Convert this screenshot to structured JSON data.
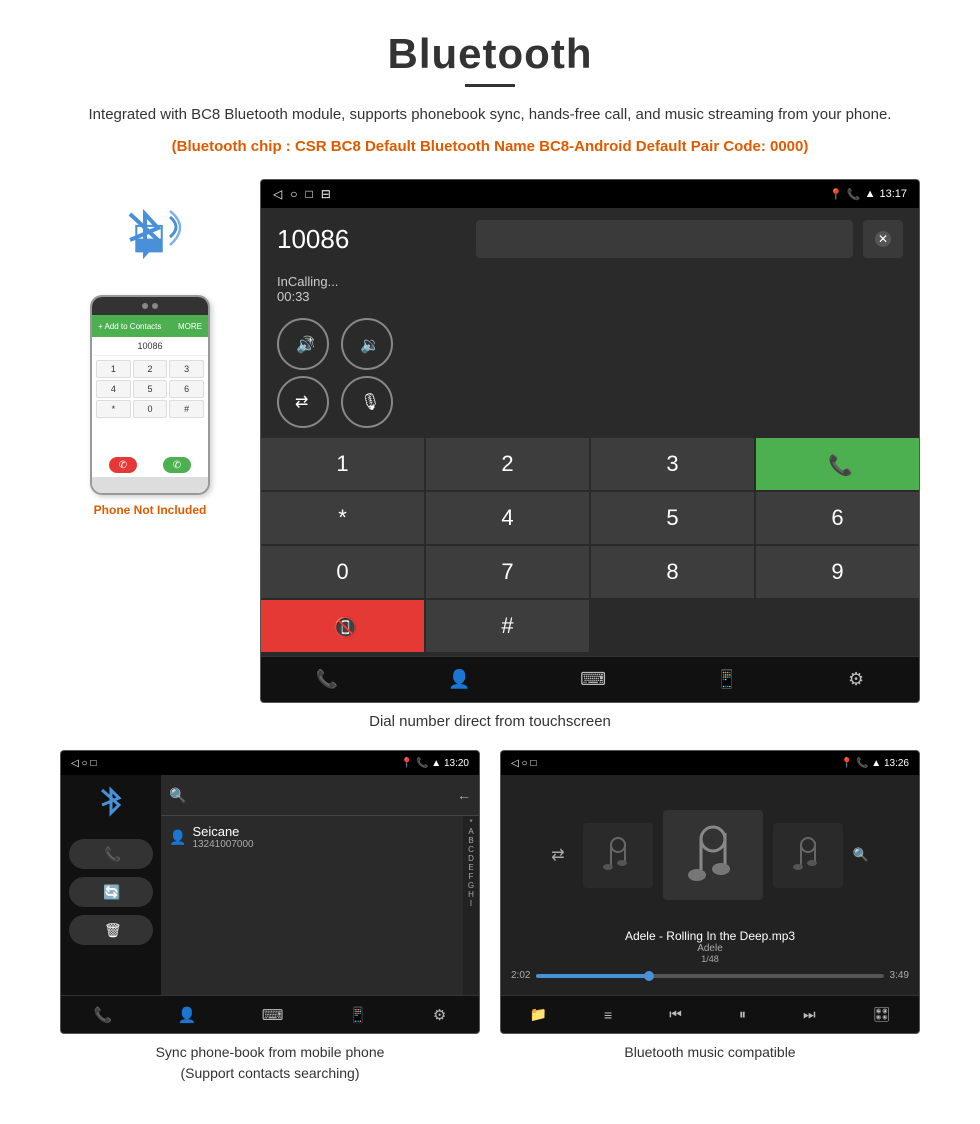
{
  "header": {
    "title": "Bluetooth",
    "subtitle": "Integrated with BC8 Bluetooth module, supports phonebook sync, hands-free call, and music streaming from your phone.",
    "specs": "(Bluetooth chip : CSR BC8    Default Bluetooth Name BC8-Android    Default Pair Code: 0000)"
  },
  "main_screen": {
    "status_bar": {
      "left_icons": [
        "◁",
        "○",
        "□",
        "📋"
      ],
      "right_icons": [
        "📍",
        "📞",
        "📶"
      ],
      "time": "13:17"
    },
    "call_number": "10086",
    "call_status": "InCalling...",
    "call_timer": "00:33",
    "keypad": {
      "keys": [
        "1",
        "2",
        "3",
        "*",
        "4",
        "5",
        "6",
        "0",
        "7",
        "8",
        "9",
        "#"
      ]
    },
    "caption": "Dial number direct from touchscreen"
  },
  "phonebook_screen": {
    "status_bar": {
      "time": "13:20"
    },
    "contact": {
      "name": "Seicane",
      "phone": "13241007000"
    },
    "alpha_list": [
      "*",
      "A",
      "B",
      "C",
      "D",
      "E",
      "F",
      "G",
      "H",
      "I"
    ],
    "caption_line1": "Sync phone-book from mobile phone",
    "caption_line2": "(Support contacts searching)"
  },
  "music_screen": {
    "status_bar": {
      "time": "13:26"
    },
    "song_title": "Adele - Rolling In the Deep.mp3",
    "artist": "Adele",
    "track_info": "1/48",
    "time_current": "2:02",
    "time_total": "3:49",
    "progress_percent": 32,
    "caption": "Bluetooth music compatible"
  },
  "phone_device": {
    "not_included": "Phone Not Included",
    "number": "10086",
    "keys": [
      "1",
      "2",
      "3",
      "4",
      "5",
      "6",
      "*",
      "0",
      "#"
    ]
  },
  "nav_icons": {
    "phone": "📞",
    "contacts": "👤",
    "keypad": "⌨",
    "device": "📱",
    "settings": "⚙"
  }
}
